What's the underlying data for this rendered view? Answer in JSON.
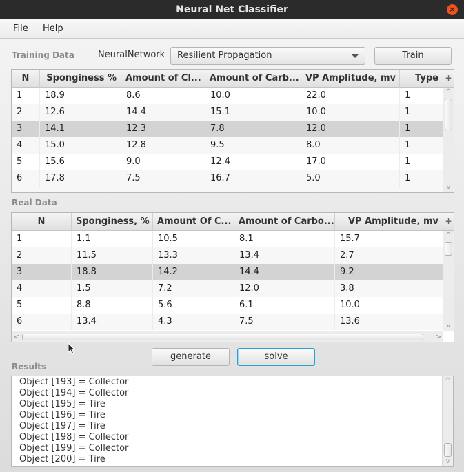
{
  "window": {
    "title": "Neural Net Classifier"
  },
  "menu": [
    "File",
    "Help"
  ],
  "training": {
    "label": "Training Data",
    "network_label": "NeuralNetwork",
    "algorithm": "Resilient Propagation",
    "train_button": "Train",
    "columns": [
      "N",
      "Sponginess %",
      "Amount of Cl...",
      "Amount of Carb...",
      "VP Amplitude, mv",
      "Type"
    ],
    "rows": [
      [
        "1",
        "18.9",
        "8.6",
        "10.0",
        "22.0",
        "1"
      ],
      [
        "2",
        "12.6",
        "14.4",
        "15.1",
        "10.0",
        "1"
      ],
      [
        "3",
        "14.1",
        "12.3",
        "7.8",
        "12.0",
        "1"
      ],
      [
        "4",
        "15.0",
        "12.8",
        "9.5",
        "8.0",
        "1"
      ],
      [
        "5",
        "15.6",
        "9.0",
        "12.4",
        "17.0",
        "1"
      ],
      [
        "6",
        "17.8",
        "7.5",
        "16.7",
        "5.0",
        "1"
      ]
    ],
    "selected_row": 3
  },
  "real": {
    "label": "Real Data",
    "columns": [
      "N",
      "Sponginess, %",
      "Amount Of C...",
      "Amount of Carbo...",
      "VP Amplitude, mv"
    ],
    "rows": [
      [
        "1",
        "1.1",
        "10.5",
        "8.1",
        "15.7"
      ],
      [
        "2",
        "11.5",
        "13.3",
        "13.4",
        "2.7"
      ],
      [
        "3",
        "18.8",
        "14.2",
        "14.4",
        "9.2"
      ],
      [
        "4",
        "1.5",
        "7.2",
        "12.0",
        "3.8"
      ],
      [
        "5",
        "8.8",
        "5.6",
        "6.1",
        "10.0"
      ],
      [
        "6",
        "13.4",
        "4.3",
        "7.5",
        "13.6"
      ]
    ],
    "selected_row": 3
  },
  "actions": {
    "generate": "generate",
    "solve": "solve"
  },
  "results": {
    "label": "Results",
    "lines": [
      "Object [193] = Collector",
      "Object [194] = Collector",
      "Object [195] = Tire",
      "Object [196] = Tire",
      "Object [197] = Tire",
      "Object [198] = Collector",
      "Object [199] = Collector",
      "Object [200] = Tire"
    ]
  },
  "icons": {
    "close": "×",
    "plus": "+",
    "up": "^",
    "down": "v",
    "left": "<",
    "right": ">"
  }
}
